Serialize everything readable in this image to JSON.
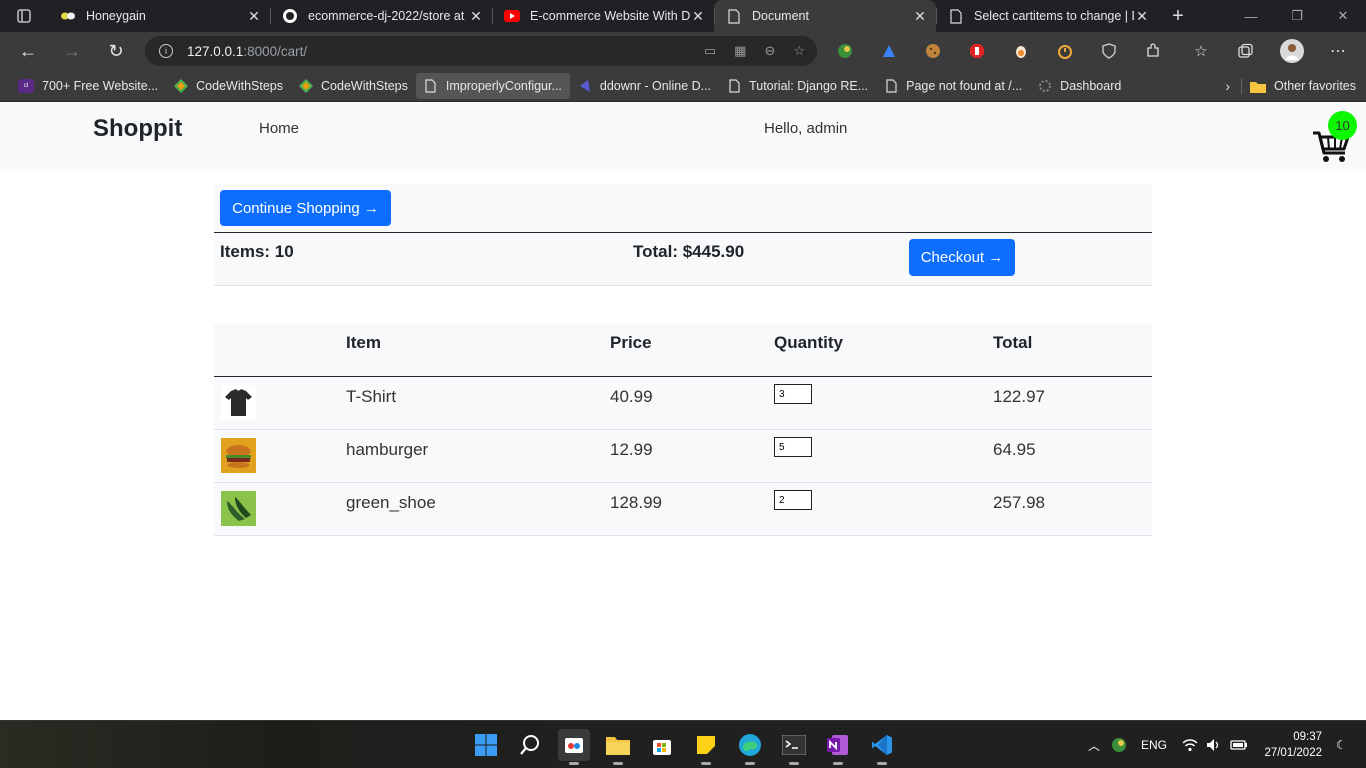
{
  "browser": {
    "tabs": [
      {
        "title": "Honeygain",
        "active": false
      },
      {
        "title": "ecommerce-dj-2022/store at",
        "active": false
      },
      {
        "title": "E-commerce Website With Dj",
        "active": false
      },
      {
        "title": "Document",
        "active": true
      },
      {
        "title": "Select cartitems to change | D",
        "active": false
      }
    ],
    "url_host": "127.0.0.1",
    "url_path": ":8000/cart/",
    "bookmarks": [
      "700+ Free Website...",
      "CodeWithSteps",
      "CodeWithSteps",
      "ImproperlyConfigur...",
      "ddownr - Online D...",
      "Tutorial: Django RE...",
      "Page not found at /...",
      "Dashboard"
    ],
    "other_favorites": "Other favorites"
  },
  "site": {
    "brand": "Shoppit",
    "nav_home": "Home",
    "greeting": "Hello, admin",
    "cart_count": "10"
  },
  "summary": {
    "continue_label": "Continue Shopping →",
    "items_label": "Items: 10",
    "total_label": "Total: $445.90",
    "checkout_label": "Checkout →"
  },
  "table": {
    "headers": [
      "Item",
      "Price",
      "Quantity",
      "Total"
    ],
    "rows": [
      {
        "name": "T-Shirt",
        "price": "40.99",
        "quantity": "3",
        "total": "122.97"
      },
      {
        "name": "hamburger",
        "price": "12.99",
        "quantity": "5",
        "total": "64.95"
      },
      {
        "name": "green_shoe",
        "price": "128.99",
        "quantity": "2",
        "total": "257.98"
      }
    ]
  },
  "taskbar": {
    "language": "ENG",
    "time": "09:37",
    "date": "27/01/2022"
  },
  "colors": {
    "primary": "#0d6efd",
    "badge": "#0cf700"
  }
}
